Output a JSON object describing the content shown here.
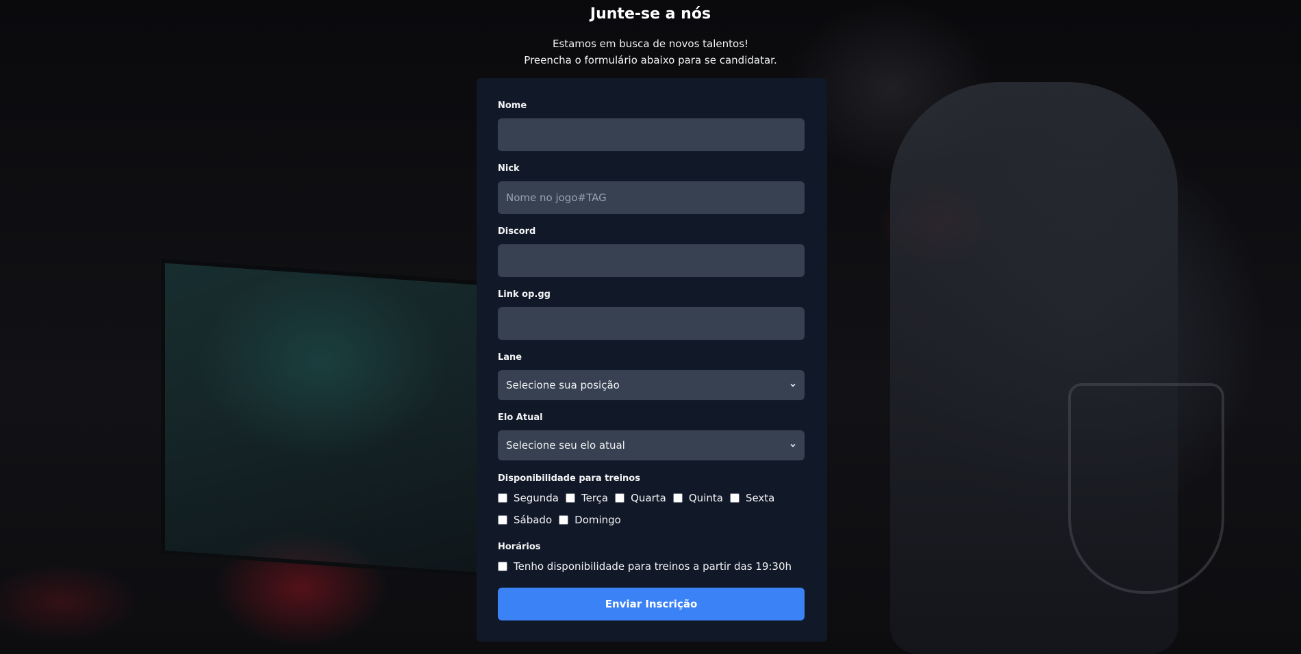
{
  "header": {
    "title": "Junte-se a nós",
    "subtitle_line1": "Estamos em busca de novos talentos!",
    "subtitle_line2": "Preencha o formulário abaixo para se candidatar."
  },
  "form": {
    "nome": {
      "label": "Nome",
      "value": "",
      "placeholder": ""
    },
    "nick": {
      "label": "Nick",
      "value": "",
      "placeholder": "Nome no jogo#TAG"
    },
    "discord": {
      "label": "Discord",
      "value": "",
      "placeholder": ""
    },
    "opgg": {
      "label": "Link op.gg",
      "value": "",
      "placeholder": ""
    },
    "lane": {
      "label": "Lane",
      "selected": "Selecione sua posição"
    },
    "elo": {
      "label": "Elo Atual",
      "selected": "Selecione seu elo atual"
    },
    "availability": {
      "label": "Disponibilidade para treinos",
      "days": [
        "Segunda",
        "Terça",
        "Quarta",
        "Quinta",
        "Sexta",
        "Sábado",
        "Domingo"
      ]
    },
    "schedule": {
      "label": "Horários",
      "option": "Tenho disponibilidade para treinos a partir das 19:30h"
    },
    "submit_label": "Enviar Inscrição"
  },
  "colors": {
    "card_bg": "#111827",
    "input_bg": "#374151",
    "accent": "#3b82f6"
  },
  "icons": {
    "select_arrow": "chevron-down-icon"
  }
}
